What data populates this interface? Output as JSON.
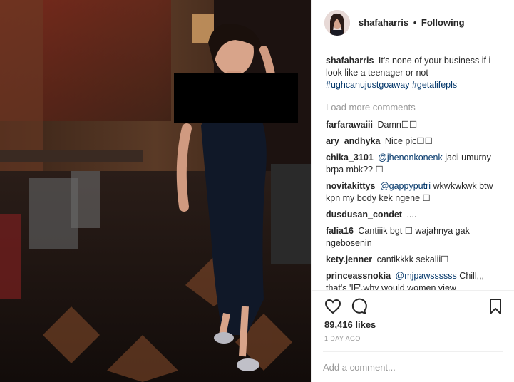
{
  "header": {
    "username": "shafaharris",
    "separator": "•",
    "follow_status": "Following"
  },
  "caption": {
    "username": "shafaharris",
    "text": "It's none of your business if i look like a teenager or not",
    "hashtags": "#ughcanujustgoaway #getalifepls"
  },
  "load_more": "Load more comments",
  "comments": [
    {
      "user": "farfarawaiii",
      "mention": "",
      "text": "Damn☐☐"
    },
    {
      "user": "ary_andhyka",
      "mention": "",
      "text": "Nice pic☐☐"
    },
    {
      "user": "chika_3101",
      "mention": "@jhenonkonenk",
      "text": "jadi umurny brpa mbk?? ☐"
    },
    {
      "user": "novitakittys",
      "mention": "@gappyputri",
      "text": "wkwkwkwk btw kpn my body kek ngene ☐"
    },
    {
      "user": "dusdusan_condet",
      "mention": "",
      "text": "...."
    },
    {
      "user": "falia16",
      "mention": "",
      "text": "Cantiiik bgt ☐ wajahnya gak ngebosenin"
    },
    {
      "user": "kety.jenner",
      "mention": "",
      "text": "cantikkkk sekalii☐"
    },
    {
      "user": "princeassnokia",
      "mention": "@mjpawssssss",
      "text": "Chill,,, that's 'IF',why would women view themselves as objects?Well I know that men see women as objects, but it was made for the other way around too"
    }
  ],
  "likes": "89,416 likes",
  "time": "1 DAY AGO",
  "add_comment_placeholder": "Add a comment...",
  "icons": {
    "like": "heart-icon",
    "comment": "comment-icon",
    "save": "bookmark-icon"
  },
  "colors": {
    "mention_link": "#003569",
    "muted": "#999999",
    "text": "#262626"
  }
}
